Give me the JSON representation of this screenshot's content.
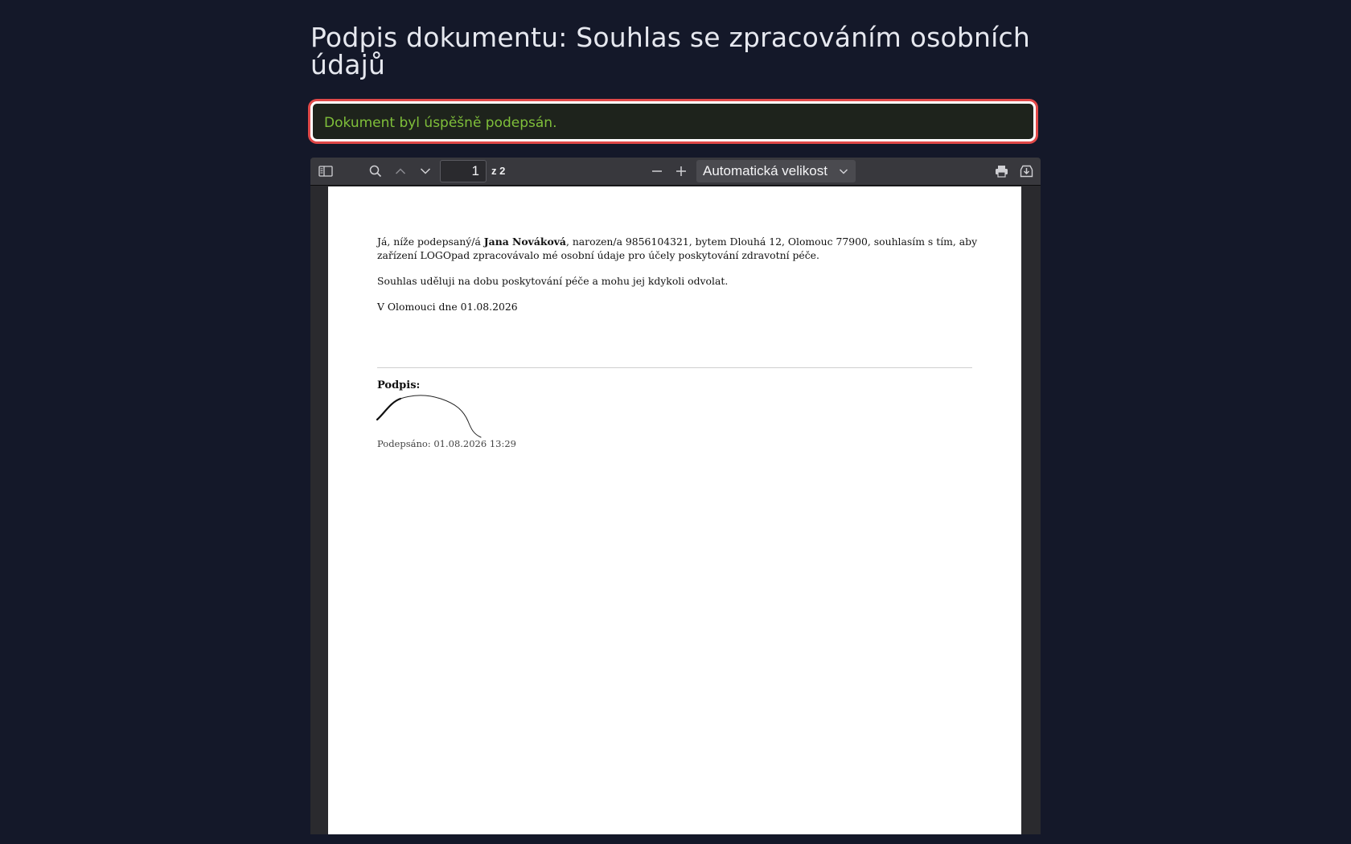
{
  "page": {
    "title": "Podpis dokumentu: Souhlas se zpracováním osobních údajů"
  },
  "status": {
    "message": "Dokument byl úspěšně podepsán."
  },
  "viewer": {
    "toolbar": {
      "page_number": "1",
      "page_count": "z 2",
      "zoom_label": "Automatická velikost"
    },
    "document": {
      "intro_before": "Já, níže podepsaný/á ",
      "name": "Jana Nováková",
      "intro_after": ", narozen/a 9856104321, bytem Dlouhá 12, Olomouc 77900, souhlasím s tím, aby zařízení LOGOpad zpracovávalo mé osobní údaje pro účely poskytování zdravotní péče.",
      "consent_duration": "Souhlas uděluji na dobu poskytování péče a mohu jej kdykoli odvolat.",
      "place_date": "V Olomouci dne 01.08.2026",
      "signature_label": "Podpis:",
      "signed_at": "Podepsáno: 01.08.2026 13:29"
    }
  },
  "icons": {
    "sidebar": "sidebar-toggle-icon",
    "search": "search-icon",
    "prev": "chevron-up-icon",
    "next": "chevron-down-icon",
    "zoom_out": "minus-icon",
    "zoom_in": "plus-icon",
    "print": "printer-icon",
    "save": "download-icon"
  },
  "colors": {
    "background": "#141829",
    "success_text": "#7fbf3a",
    "highlight_border": "#e04848"
  }
}
